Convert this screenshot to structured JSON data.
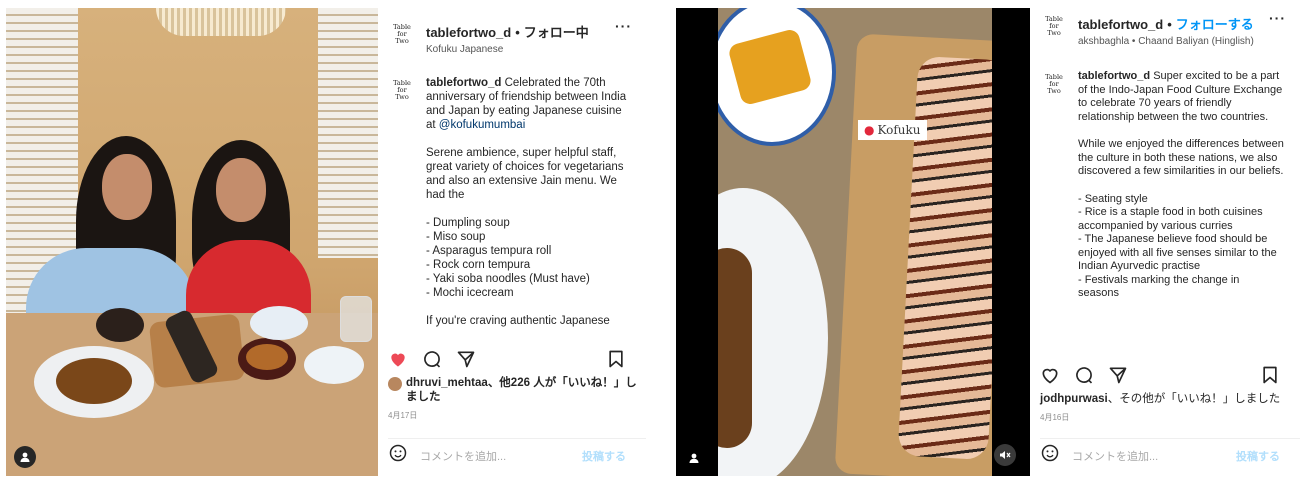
{
  "posts": [
    {
      "header": {
        "logo_text": "Table for Two",
        "username": "tablefortwo_d",
        "separator": "•",
        "follow_label": "フォロー中",
        "subtitle": "Kofuku Japanese",
        "more_icon": "more-horizontal-icon"
      },
      "caption": {
        "username": "tablefortwo_d",
        "text_1": "Celebrated the 70th anniversary of friendship between India and Japan by eating Japanese cuisine at ",
        "mention": "@kofukumumbai",
        "p2": "Serene ambience, super helpful staff, great variety of choices for vegetarians and also an extensive Jain menu. We had the",
        "items": [
          "- Dumpling soup",
          "- Miso soup",
          "- Asparagus tempura roll",
          "- Rock corn tempura",
          "- Yaki soba noodles (Must have)",
          "- Mochi icecream"
        ],
        "p4": "If you're craving authentic Japanese"
      },
      "actions": {
        "liked": true,
        "like_color": "#ed4956"
      },
      "likes": {
        "names": "dhruvi_mehtaa",
        "rest": "、他226 人が「いいね！」しました"
      },
      "date": "4月17日",
      "comment": {
        "placeholder": "コメントを追加...",
        "post_label": "投稿する"
      }
    },
    {
      "header": {
        "logo_text": "Table for Two",
        "username": "tablefortwo_d",
        "separator": "•",
        "follow_label": "フォローする",
        "subtitle": "akshbaghla • Chaand Baliyan (Hinglish)",
        "more_icon": "more-horizontal-icon"
      },
      "photo": {
        "location_tag": "Kofuku"
      },
      "caption": {
        "username": "tablefortwo_d",
        "text_1": "Super excited to be a part of the Indo-Japan Food Culture Exchange to celebrate 70 years of friendly relationship between the two countries.",
        "p2": "While we enjoyed the differences between the culture in both these nations, we also discovered a few similarities in our beliefs.",
        "items": [
          "- Seating style",
          "- Rice is a staple food in both cuisines accompanied by various curries",
          "- The Japanese believe food should be enjoyed with all five senses similar to the Indian Ayurvedic practise",
          "- Festivals marking the change in",
          "seasons"
        ]
      },
      "actions": {
        "liked": false
      },
      "likes": {
        "names": "jodhpurwasi",
        "rest": "、その他が「いいね！」しました"
      },
      "date": "4月16日",
      "comment": {
        "placeholder": "コメントを追加...",
        "post_label": "投稿する"
      }
    }
  ]
}
